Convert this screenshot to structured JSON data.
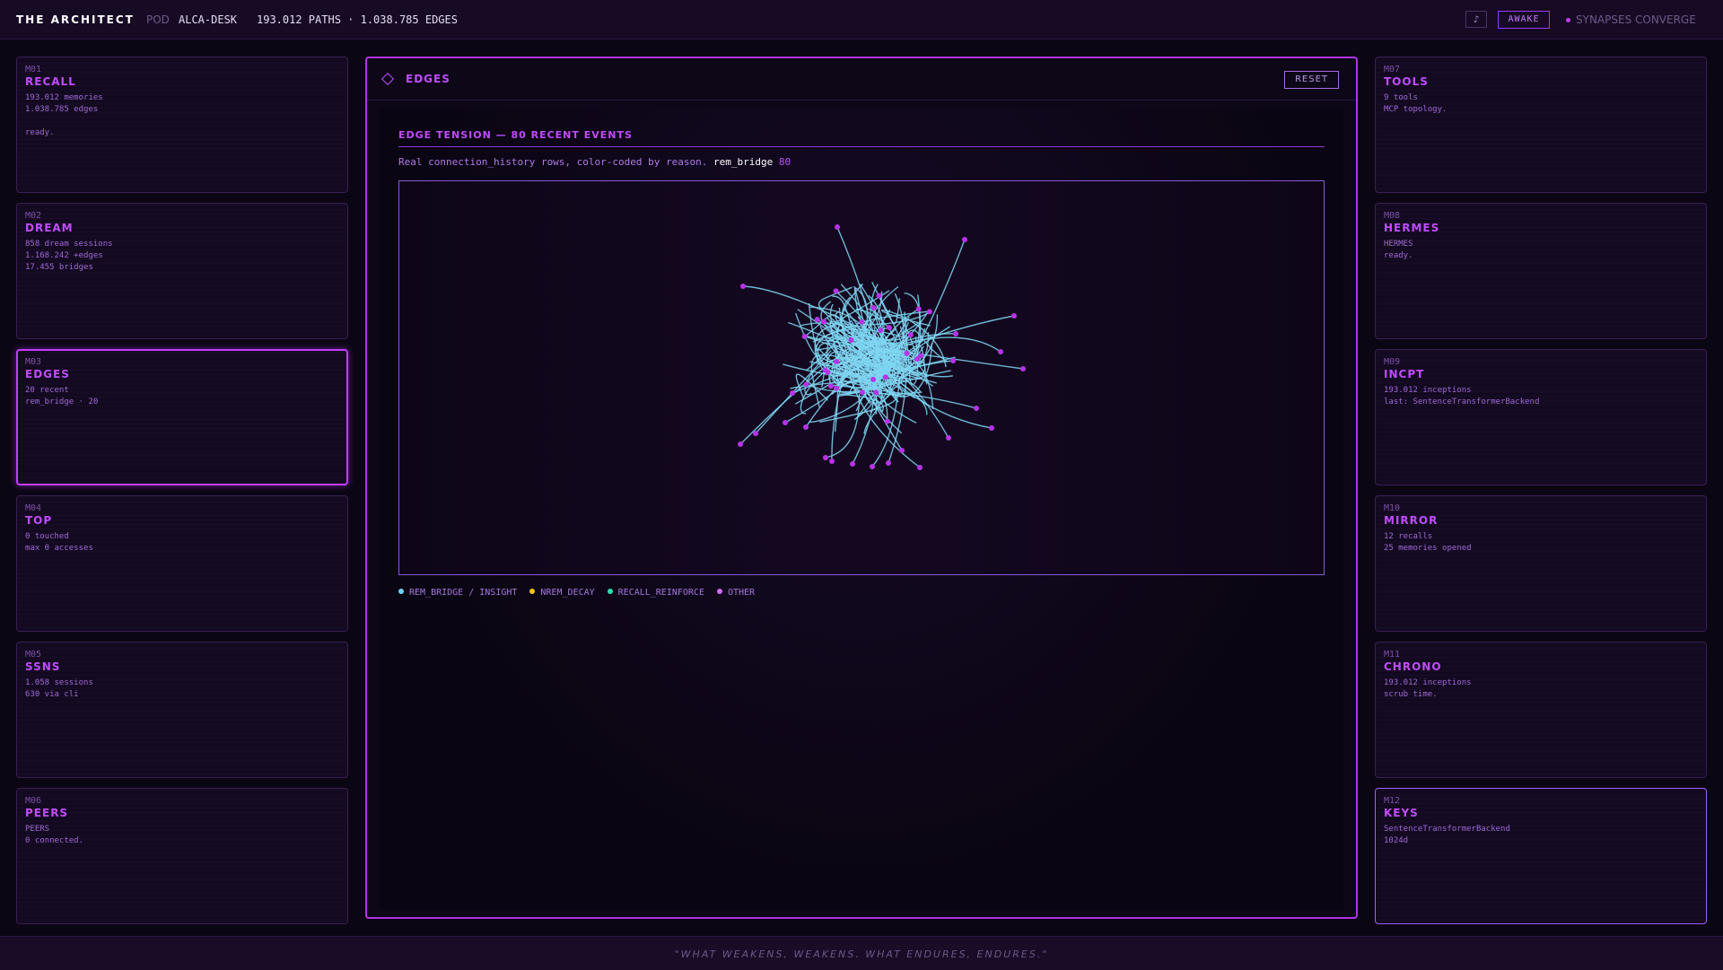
{
  "header": {
    "brand": "THE ARCHITECT",
    "pod_label": "POD",
    "pod_name": "ALCA-DESK",
    "stats": "193.012 PATHS · 1.038.785 EDGES",
    "music_icon": "music-note-icon",
    "music_glyph": "♪",
    "status_button": "AWAKE",
    "converge_text": "SYNAPSES CONVERGE"
  },
  "modules_left": [
    {
      "num": "M01",
      "title": "RECALL",
      "lines": [
        "193.012 memories",
        "1.038.785 edges",
        "",
        "ready."
      ]
    },
    {
      "num": "M02",
      "title": "DREAM",
      "lines": [
        "858 dream sessions",
        "1.168.242 +edges",
        "17.455 bridges"
      ]
    },
    {
      "num": "M03",
      "title": "EDGES",
      "lines": [
        "20 recent",
        "rem_bridge · 20"
      ]
    },
    {
      "num": "M04",
      "title": "TOP",
      "lines": [
        "0 touched",
        "max 0 accesses"
      ]
    },
    {
      "num": "M05",
      "title": "SSNS",
      "lines": [
        "1.058 sessions",
        "630 via cli"
      ]
    },
    {
      "num": "M06",
      "title": "PEERS",
      "lines": [
        "PEERS",
        "0 connected."
      ]
    }
  ],
  "modules_right": [
    {
      "num": "M07",
      "title": "TOOLS",
      "lines": [
        "9 tools",
        "MCP topology."
      ]
    },
    {
      "num": "M08",
      "title": "HERMES",
      "lines": [
        "HERMES",
        "ready."
      ]
    },
    {
      "num": "M09",
      "title": "INCPT",
      "lines": [
        "193.012 inceptions",
        "last: SentenceTransformerBackend"
      ]
    },
    {
      "num": "M10",
      "title": "MIRROR",
      "lines": [
        "12 recalls",
        "25 memories opened"
      ]
    },
    {
      "num": "M11",
      "title": "CHRONO",
      "lines": [
        "193.012 inceptions",
        "scrub time."
      ]
    },
    {
      "num": "M12",
      "title": "KEYS",
      "lines": [
        "SentenceTransformerBackend",
        "1024d"
      ]
    }
  ],
  "center": {
    "title": "EDGES",
    "reset_label": "RESET",
    "tension_title": "EDGE TENSION — 80 RECENT EVENTS",
    "desc_prefix": "Real connection_history rows, color-coded by reason.",
    "desc_highlight": "rem_bridge",
    "desc_count": "80",
    "legend": [
      {
        "label": "REM_BRIDGE / INSIGHT",
        "color": "#6fd3f5"
      },
      {
        "label": "NREM_DECAY",
        "color": "#f5c518"
      },
      {
        "label": "RECALL_REINFORCE",
        "color": "#2ee0b0"
      },
      {
        "label": "OTHER",
        "color": "#d06cff"
      }
    ],
    "edge_color": "#7fd6f2",
    "node_color": "#b733e8"
  },
  "footer": {
    "quote": "\"WHAT WEAKENS, WEAKENS. WHAT ENDURES, ENDURES.\""
  }
}
